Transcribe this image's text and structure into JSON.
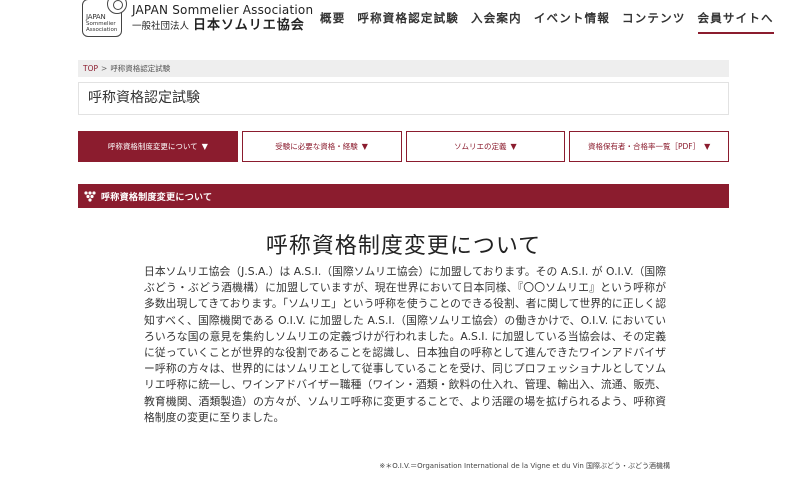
{
  "header": {
    "logo": {
      "badge_lines": [
        "JAPAN",
        "Sommelier",
        "Association"
      ],
      "name_en": "JAPAN Sommelier Association",
      "name_ja_prefix": "一般社団法人",
      "name_ja": "日本ソムリエ協会"
    },
    "nav": [
      {
        "label": "概要"
      },
      {
        "label": "呼称資格認定試験"
      },
      {
        "label": "入会案内"
      },
      {
        "label": "イベント情報"
      },
      {
        "label": "コンテンツ"
      },
      {
        "label": "会員サイトへ"
      }
    ]
  },
  "breadcrumb": {
    "home": "TOP",
    "separator": ">",
    "current": "呼称資格認定試験"
  },
  "page_title": "呼称資格認定試験",
  "tabs": [
    {
      "label": "呼称資格制度変更について",
      "arrow": "▼",
      "active": true
    },
    {
      "label": "受験に必要な資格・経験",
      "arrow": "▼",
      "active": false
    },
    {
      "label": "ソムリエの定義",
      "arrow": "▼",
      "active": false
    },
    {
      "label": "資格保有者・合格率一覧［PDF］",
      "arrow": "▼",
      "active": false
    }
  ],
  "section_header": "呼称資格制度変更について",
  "main_heading": "呼称資格制度変更について",
  "body_text": "日本ソムリエ協会（J.S.A.）は A.S.I.（国際ソムリエ協会）に加盟しております。その A.S.I. が O.I.V.（国際ぶどう・ぶどう酒機構）に加盟していますが、現在世界において日本同様、『〇〇ソムリエ』という呼称が多数出現してきております。「ソムリエ」という呼称を使うことのできる役割、者に関して世界的に正しく認知すべく、国際機関である O.I.V. に加盟した A.S.I.（国際ソムリエ協会）の働きかけで、O.I.V. においていろいろな国の意見を集約しソムリエの定義づけが行われました。A.S.I. に加盟している当協会は、その定義に従っていくことが世界的な役割であることを認識し、日本独自の呼称として進んできたワインアドバイザー呼称の方々は、世界的にはソムリエとして従事していることを受け、同じプロフェッショナルとしてソムリエ呼称に統一し、ワインアドバイザー職種（ワイン・酒類・飲料の仕入れ、管理、輸出入、流通、販売、教育機関、酒類製造）の方々が、ソムリエ呼称に変更することで、より活躍の場を拡げられるよう、呼称資格制度の変更に至りました。",
  "footnote": "※＊O.I.V.＝Organisation International de la Vigne et du Vin 国際ぶどう・ぶどう酒機構",
  "colors": {
    "brand": "#8b1c2e",
    "breadcrumb_bg": "#eeeeee"
  }
}
